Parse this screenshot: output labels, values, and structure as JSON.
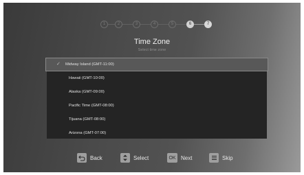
{
  "stepper": {
    "steps": [
      "1",
      "2",
      "3",
      "4",
      "5",
      "6",
      "7"
    ],
    "current_step": 6
  },
  "header": {
    "title": "Time Zone",
    "subtitle": "Select time zone"
  },
  "time_zones": [
    {
      "label": "Midway Island (GMT-11:00)",
      "selected": true
    },
    {
      "label": "Hawaii (GMT-10:00)",
      "selected": false
    },
    {
      "label": "Alaska (GMT-09:00)",
      "selected": false
    },
    {
      "label": "Pacific Time (GMT-08:00)",
      "selected": false
    },
    {
      "label": "Tijuana (GMT-08:00)",
      "selected": false
    },
    {
      "label": "Arizona (GMT-07:00)",
      "selected": false
    }
  ],
  "footer": {
    "back_label": "Back",
    "select_label": "Select",
    "ok_key": "OK",
    "next_label": "Next",
    "skip_label": "Skip"
  },
  "icons": {
    "back": "back-arrow-icon",
    "select": "up-down-icon",
    "ok": "ok-key-icon",
    "skip": "menu-icon",
    "check": "check-icon"
  },
  "colors": {
    "selected_row": "#585858",
    "list_background": "#242424"
  }
}
